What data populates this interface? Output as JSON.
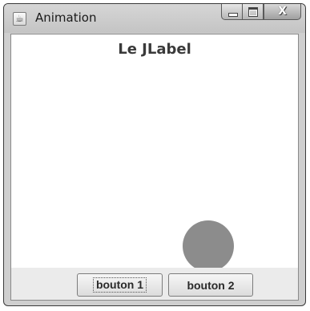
{
  "window": {
    "title": "Animation",
    "app_icon": "java-cup-icon",
    "close_glyph": "X"
  },
  "panel": {
    "label": "Le JLabel",
    "ball_color": "#8c8c8c"
  },
  "buttons": {
    "button1_label": "bouton 1",
    "button2_label": "bouton 2",
    "focused": "button1"
  }
}
